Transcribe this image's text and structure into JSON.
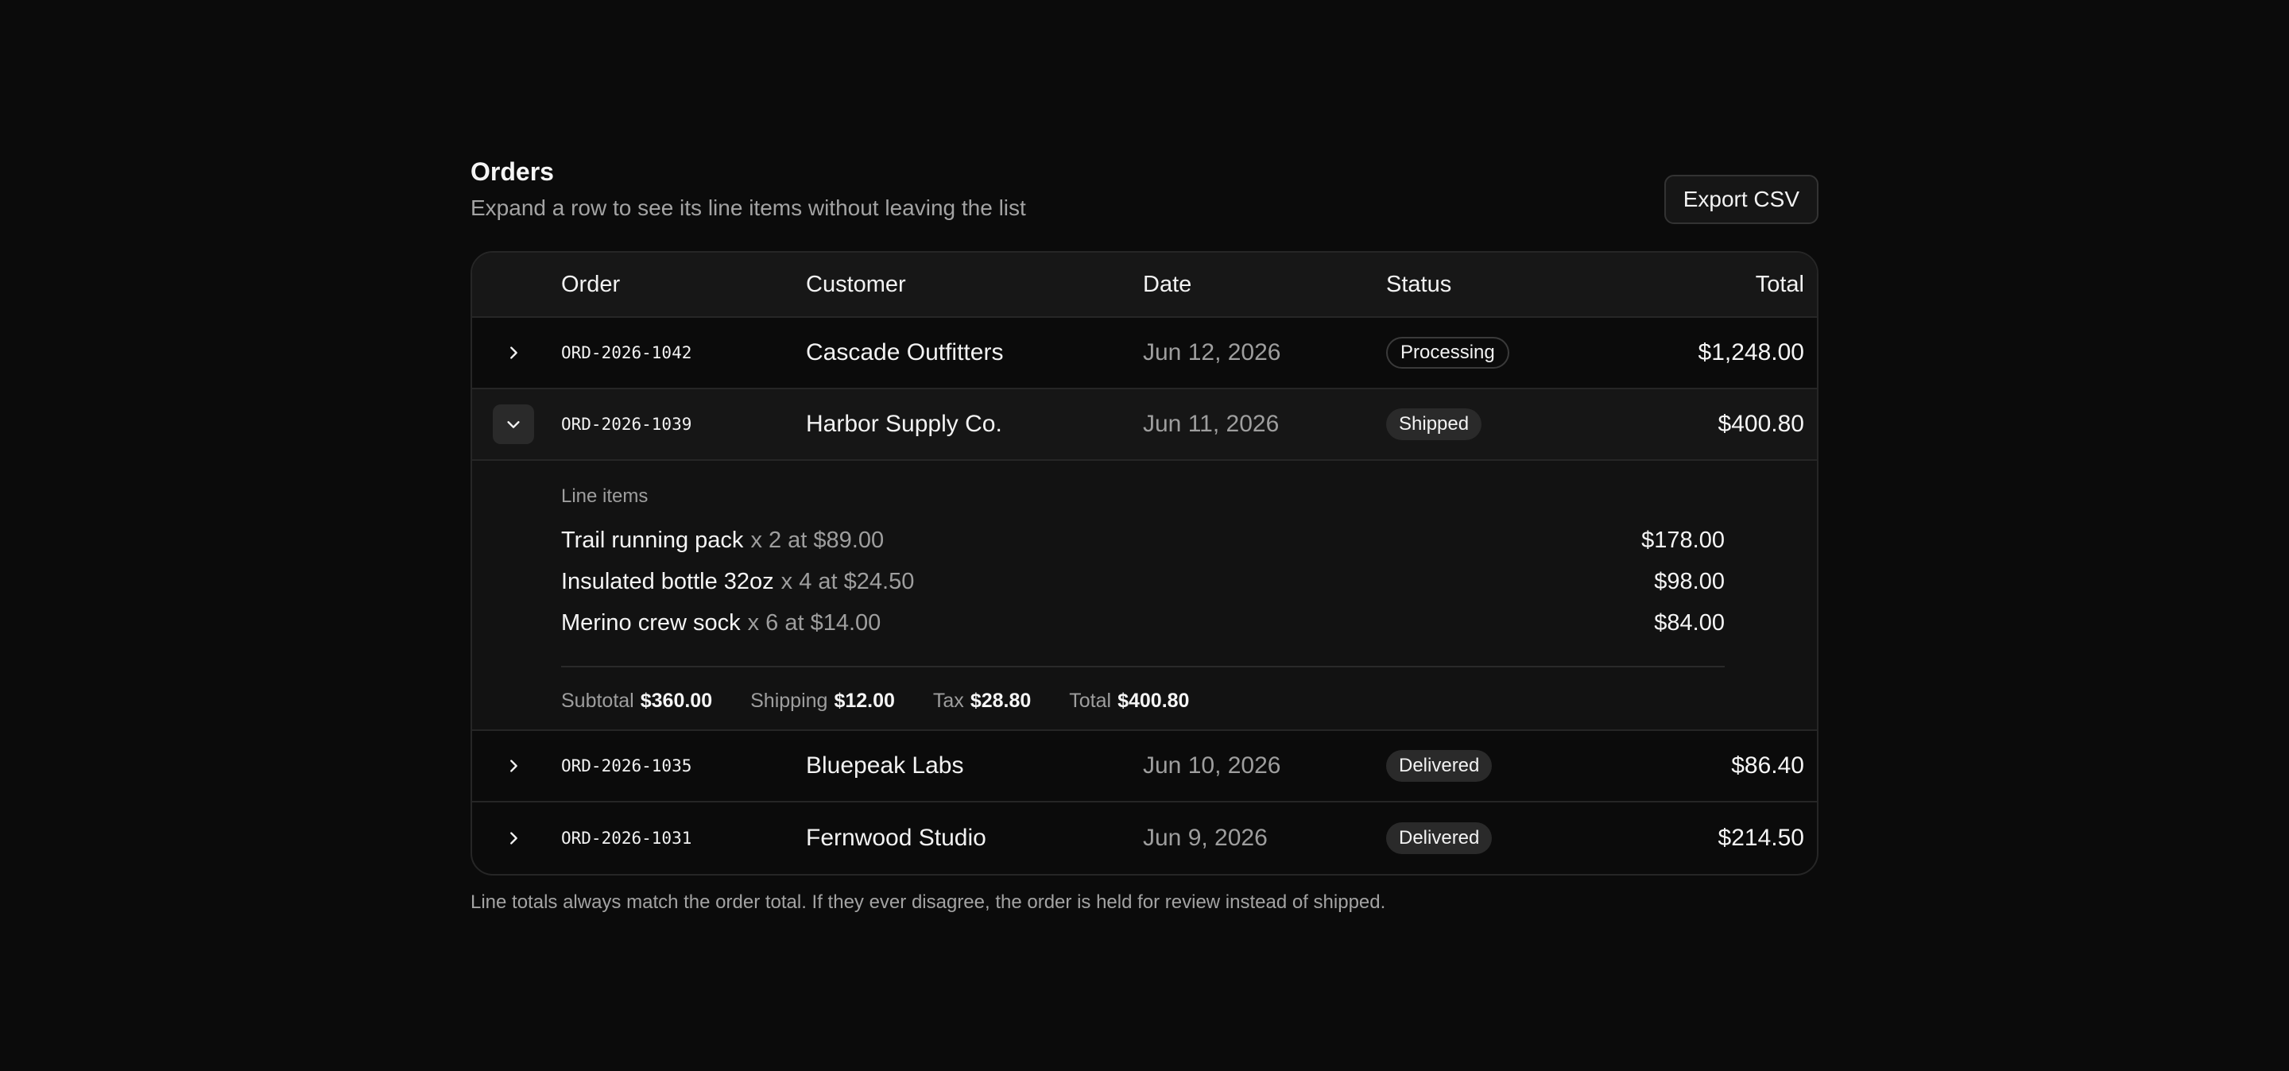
{
  "header": {
    "title": "Orders",
    "subtitle": "Expand a row to see its line items without leaving the list",
    "export_label": "Export CSV"
  },
  "table": {
    "columns": {
      "order": "Order",
      "customer": "Customer",
      "date": "Date",
      "status": "Status",
      "total": "Total"
    },
    "rows": [
      {
        "order_id": "ORD-2026-1042",
        "customer": "Cascade Outfitters",
        "date": "Jun 12, 2026",
        "status": "Processing",
        "total": "$1,248.00",
        "expanded": false
      },
      {
        "order_id": "ORD-2026-1039",
        "customer": "Harbor Supply Co.",
        "date": "Jun 11, 2026",
        "status": "Shipped",
        "total": "$400.80",
        "expanded": true,
        "details": {
          "heading": "Line items",
          "items": [
            {
              "name": "Trail running pack",
              "qty": "x 2 at $89.00",
              "amount": "$178.00"
            },
            {
              "name": "Insulated bottle 32oz",
              "qty": "x 4 at $24.50",
              "amount": "$98.00"
            },
            {
              "name": "Merino crew sock",
              "qty": "x 6 at $14.00",
              "amount": "$84.00"
            }
          ],
          "summary": {
            "subtotal_label": "Subtotal",
            "subtotal": "$360.00",
            "shipping_label": "Shipping",
            "shipping": "$12.00",
            "tax_label": "Tax",
            "tax": "$28.80",
            "total_label": "Total",
            "total": "$400.80"
          }
        }
      },
      {
        "order_id": "ORD-2026-1035",
        "customer": "Bluepeak Labs",
        "date": "Jun 10, 2026",
        "status": "Delivered",
        "total": "$86.40",
        "expanded": false
      },
      {
        "order_id": "ORD-2026-1031",
        "customer": "Fernwood Studio",
        "date": "Jun 9, 2026",
        "status": "Delivered",
        "total": "$214.50",
        "expanded": false
      }
    ]
  },
  "footnote": "Line totals always match the order total. If they ever disagree, the order is held for review instead of shipped.",
  "colors": {
    "background": "#0b0b0b",
    "badge_fill": "#2a2a2a",
    "muted_text": "#9e9e9e"
  }
}
